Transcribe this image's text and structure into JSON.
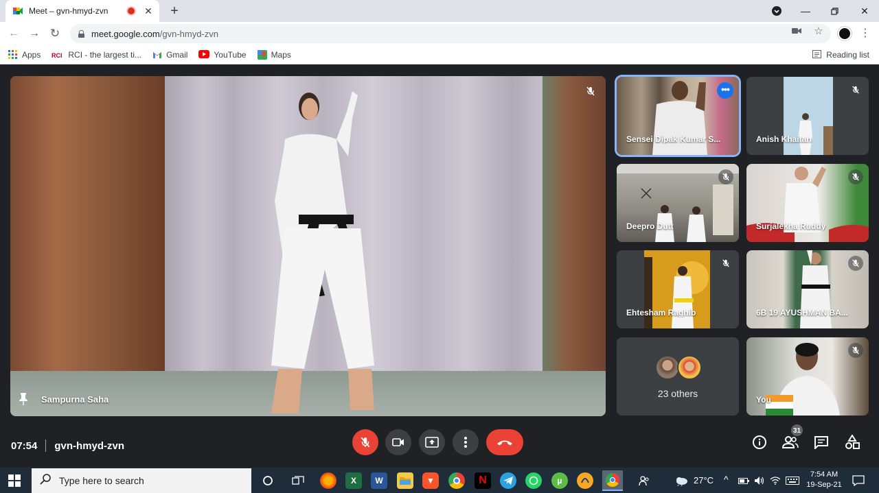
{
  "browser": {
    "tab_title": "Meet – gvn-hmyd-zvn",
    "url_host": "meet.google.com",
    "url_path": "/gvn-hmyd-zvn",
    "bookmarks": [
      {
        "label": "Apps"
      },
      {
        "label": "RCI - the largest ti..."
      },
      {
        "label": "Gmail"
      },
      {
        "label": "YouTube"
      },
      {
        "label": "Maps"
      }
    ],
    "reading_list": "Reading list"
  },
  "meeting": {
    "main_speaker": "Sampurna Saha",
    "participants": [
      {
        "name": "Sensei Dipak Kumar S..."
      },
      {
        "name": "Anish Khaitan"
      },
      {
        "name": "Deepro Dutt"
      },
      {
        "name": "Surjalekha Ruddy"
      },
      {
        "name": "Ehtesham Raghib"
      },
      {
        "name": "6B 19 AYUSHMAN BA..."
      },
      {
        "name": "You"
      }
    ],
    "others_label": "23 others",
    "time": "07:54",
    "code": "gvn-hmyd-zvn",
    "people_count": "31"
  },
  "taskbar": {
    "search_placeholder": "Type here to search",
    "temperature": "27°C",
    "clock_time": "7:54 AM",
    "clock_date": "19-Sep-21"
  },
  "colors": {
    "meet_bg": "#202124",
    "tile_bg": "#3c4043",
    "danger": "#ea4335",
    "active_outline": "#8ab4f8",
    "accent": "#1a73e8"
  }
}
